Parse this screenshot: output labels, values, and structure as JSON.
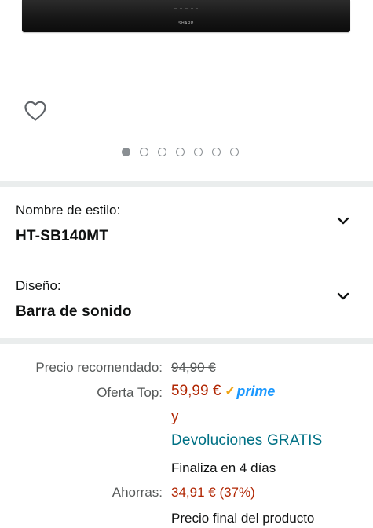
{
  "product": {
    "brand_mark": "SHARP"
  },
  "carousel": {
    "total": 7,
    "active_index": 0
  },
  "options": [
    {
      "label": "Nombre de estilo:",
      "value": "HT-SB140MT"
    },
    {
      "label": "Diseño:",
      "value": "Barra de sonido"
    }
  ],
  "pricing": {
    "recommended_label": "Precio recomendado:",
    "recommended_price": "94,90 €",
    "deal_label": "Oferta Top:",
    "deal_price": "59,99 €",
    "prime_check": "✓",
    "prime_text": "prime",
    "and_text": "y",
    "returns_text": "Devoluciones GRATIS",
    "ends_text": "Finaliza en 4 días",
    "savings_label": "Ahorras:",
    "savings_value": "34,91 € (37%)",
    "final_price_text": "Precio final del producto"
  },
  "icons": {
    "wishlist": "heart-outline-icon",
    "expand": "chevron-down-icon"
  },
  "colors": {
    "price_red": "#b12704",
    "link_teal": "#007185",
    "prime_blue": "#1a98ff",
    "muted_gray": "#565959"
  }
}
